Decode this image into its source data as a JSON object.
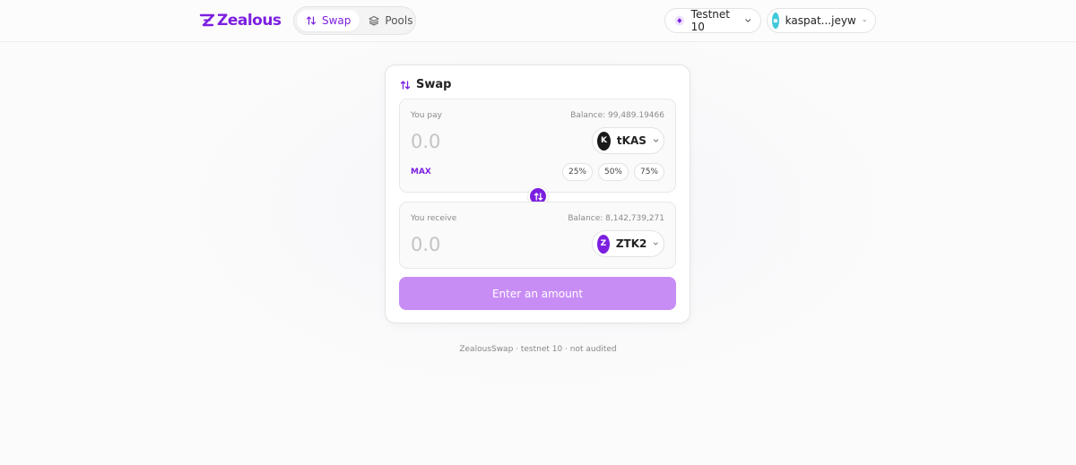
{
  "brand": {
    "name": "Zealous",
    "color": "#7c1fe0"
  },
  "nav": {
    "tabs": [
      {
        "label": "Swap",
        "icon": "swap-vertical-icon",
        "active": true
      },
      {
        "label": "Pools",
        "icon": "layers-icon",
        "active": false
      }
    ]
  },
  "network": {
    "label": "Testnet 10",
    "icon": "diamond-icon"
  },
  "wallet": {
    "label": "kaspat...jeyw",
    "icon": "avatar"
  },
  "swap": {
    "title": "Swap",
    "pay": {
      "label": "You pay",
      "balance": "Balance: 99,489.19466",
      "placeholder": "0.0",
      "token": {
        "symbol": "tKAS",
        "letter": "K",
        "color": "#1a1a1a"
      },
      "max_label": "MAX",
      "percentages": [
        "25%",
        "50%",
        "75%"
      ]
    },
    "receive": {
      "label": "You receive",
      "balance": "Balance: 8,142,739,271",
      "placeholder": "0.0",
      "token": {
        "symbol": "ZTK2",
        "letter": "Z",
        "color": "#7c1fe0"
      }
    },
    "submit_label": "Enter an amount"
  },
  "footer": {
    "text": "ZealousSwap · testnet 10 · not audited"
  }
}
